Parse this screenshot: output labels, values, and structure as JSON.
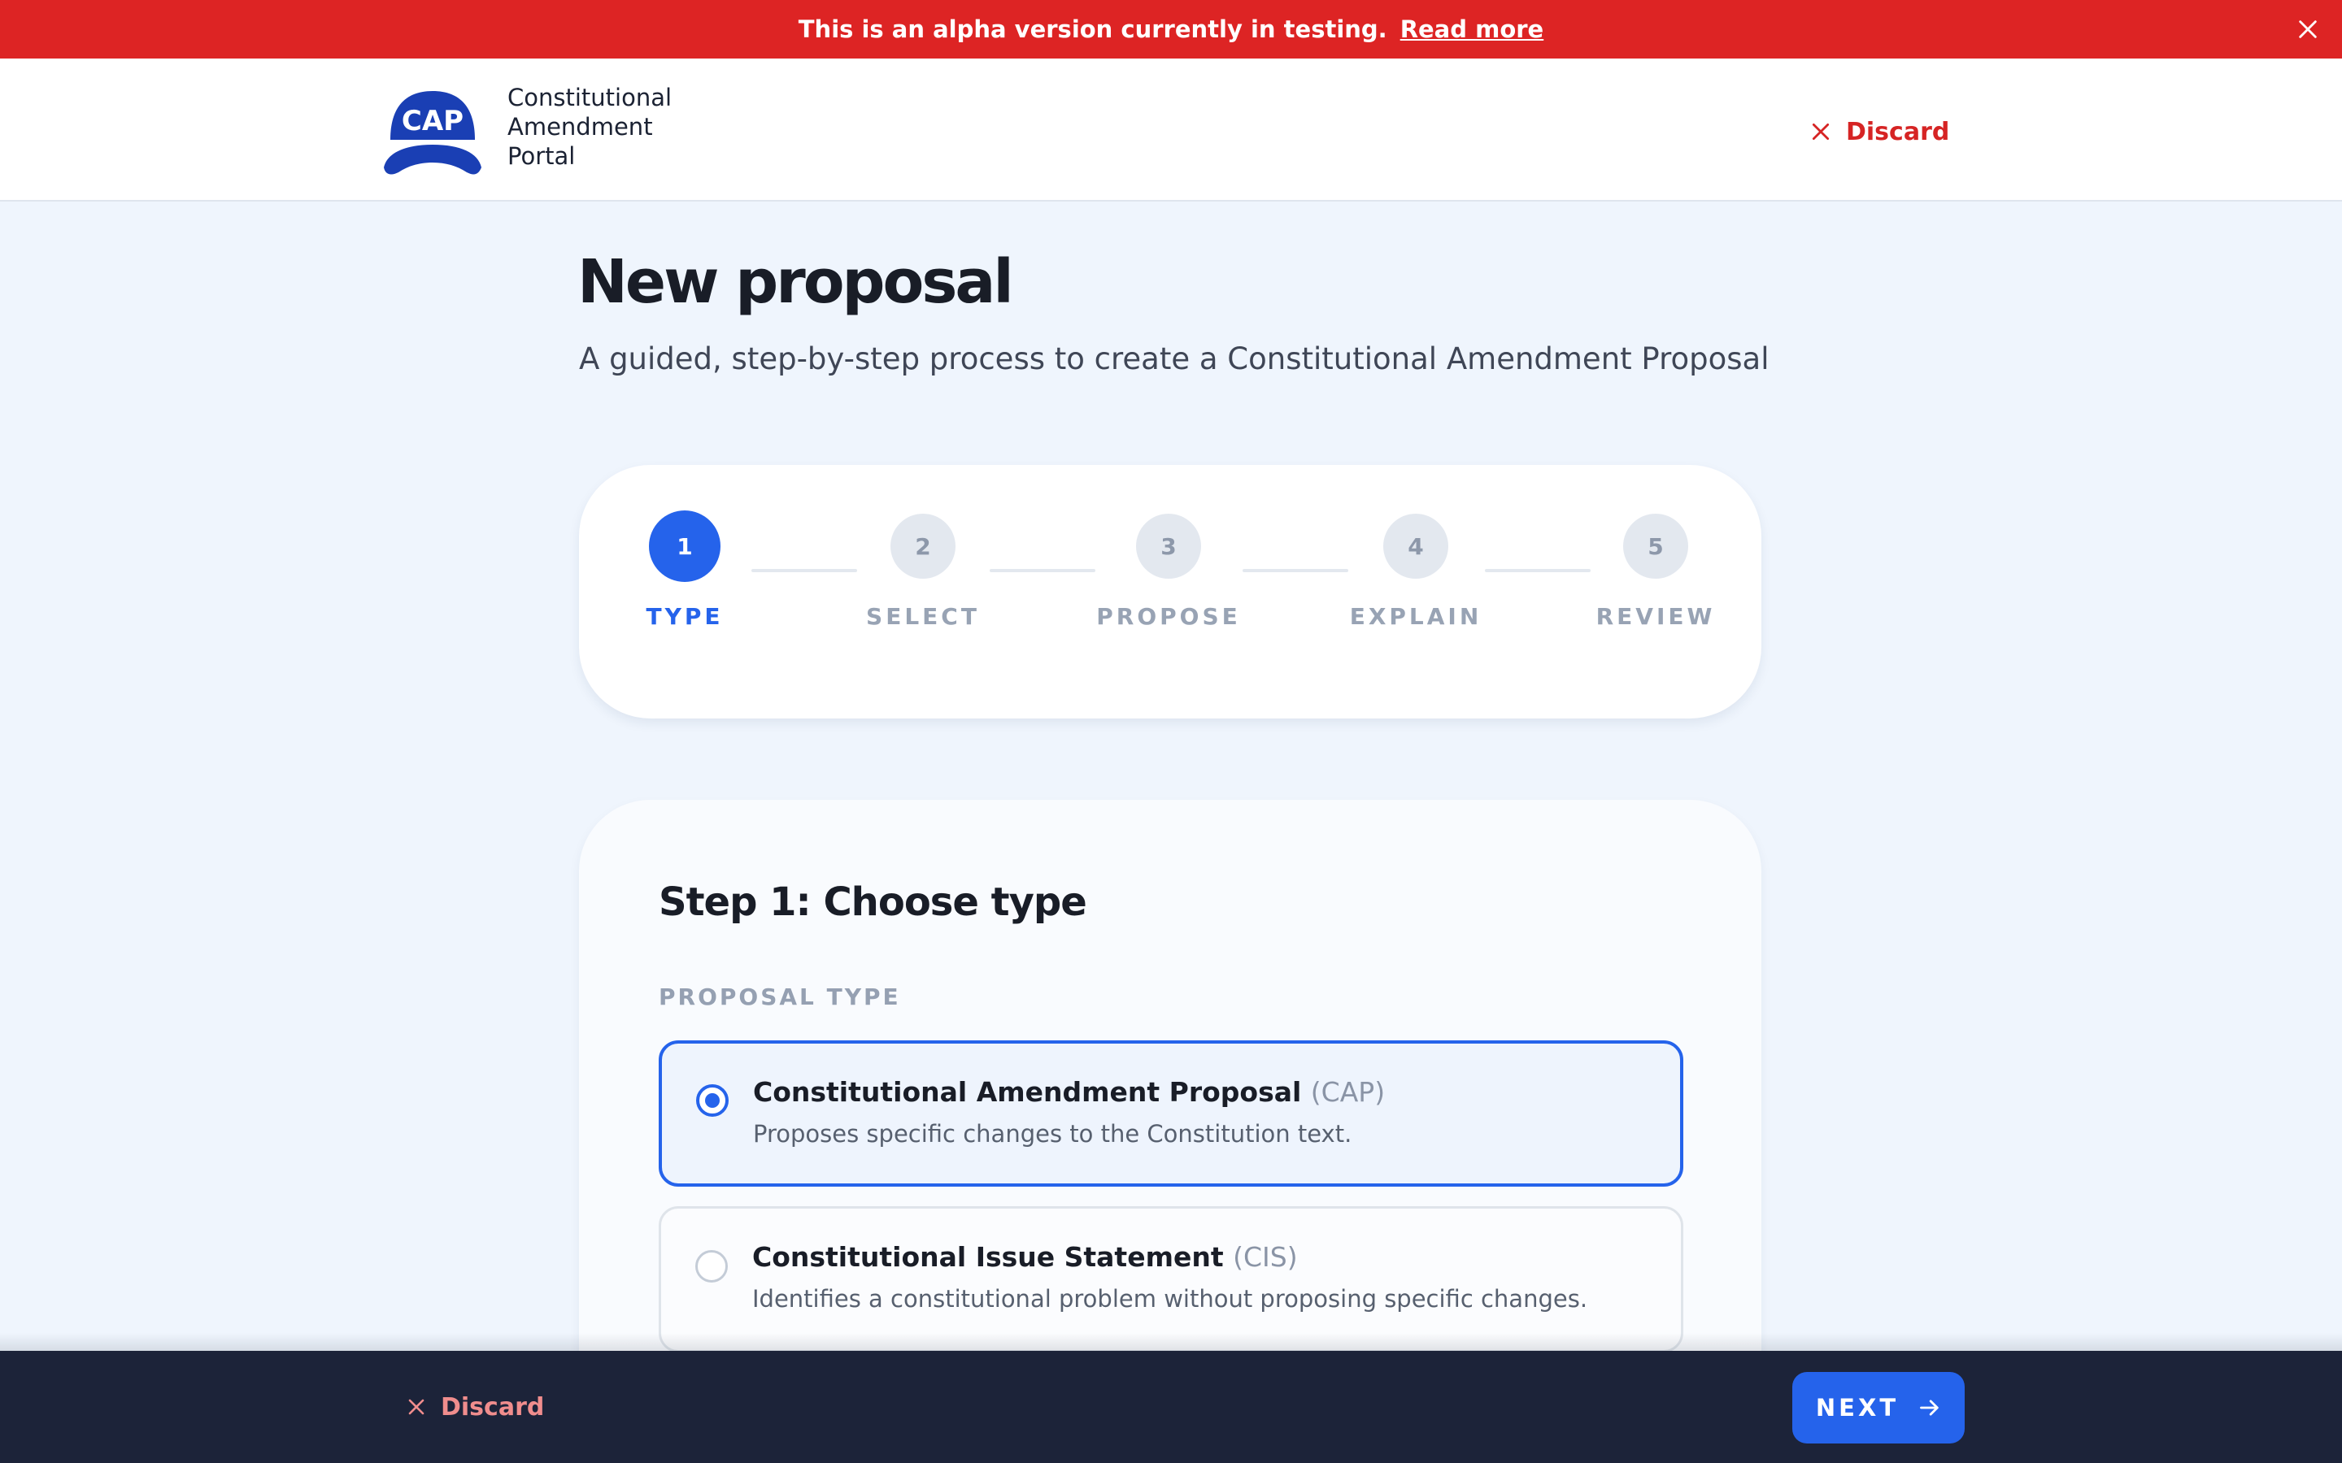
{
  "banner": {
    "message": "This is an alpha version currently in testing.",
    "link_label": "Read more",
    "close_icon": "close-icon",
    "background": "#dd2424"
  },
  "header": {
    "logo_text": "CAP",
    "brand_lines": [
      "Constitutional",
      "Amendment",
      "Portal"
    ],
    "discard_label": "Discard",
    "discard_icon": "close-icon"
  },
  "page": {
    "title": "New proposal",
    "subtitle": "A guided, step-by-step process to create a Constitutional Amendment Proposal"
  },
  "stepper": {
    "active_step": 1,
    "steps": [
      {
        "number": "1",
        "label": "TYPE"
      },
      {
        "number": "2",
        "label": "SELECT"
      },
      {
        "number": "3",
        "label": "PROPOSE"
      },
      {
        "number": "4",
        "label": "EXPLAIN"
      },
      {
        "number": "5",
        "label": "REVIEW"
      }
    ]
  },
  "form": {
    "title": "Step 1: Choose type",
    "field_label": "PROPOSAL TYPE",
    "options": [
      {
        "title": "Constitutional Amendment Proposal",
        "abbr": "(CAP)",
        "description": "Proposes specific changes to the Constitution text.",
        "selected": true
      },
      {
        "title": "Constitutional Issue Statement",
        "abbr": "(CIS)",
        "description": "Identifies a constitutional problem without proposing specific changes.",
        "selected": false
      }
    ]
  },
  "footer": {
    "discard_label": "Discard",
    "next_label": "NEXT",
    "next_icon": "arrow-right-icon"
  },
  "colors": {
    "accent": "#2563eb",
    "danger": "#dd2424",
    "footer_bg": "#1c2339",
    "page_bg": "#eff5fd"
  }
}
